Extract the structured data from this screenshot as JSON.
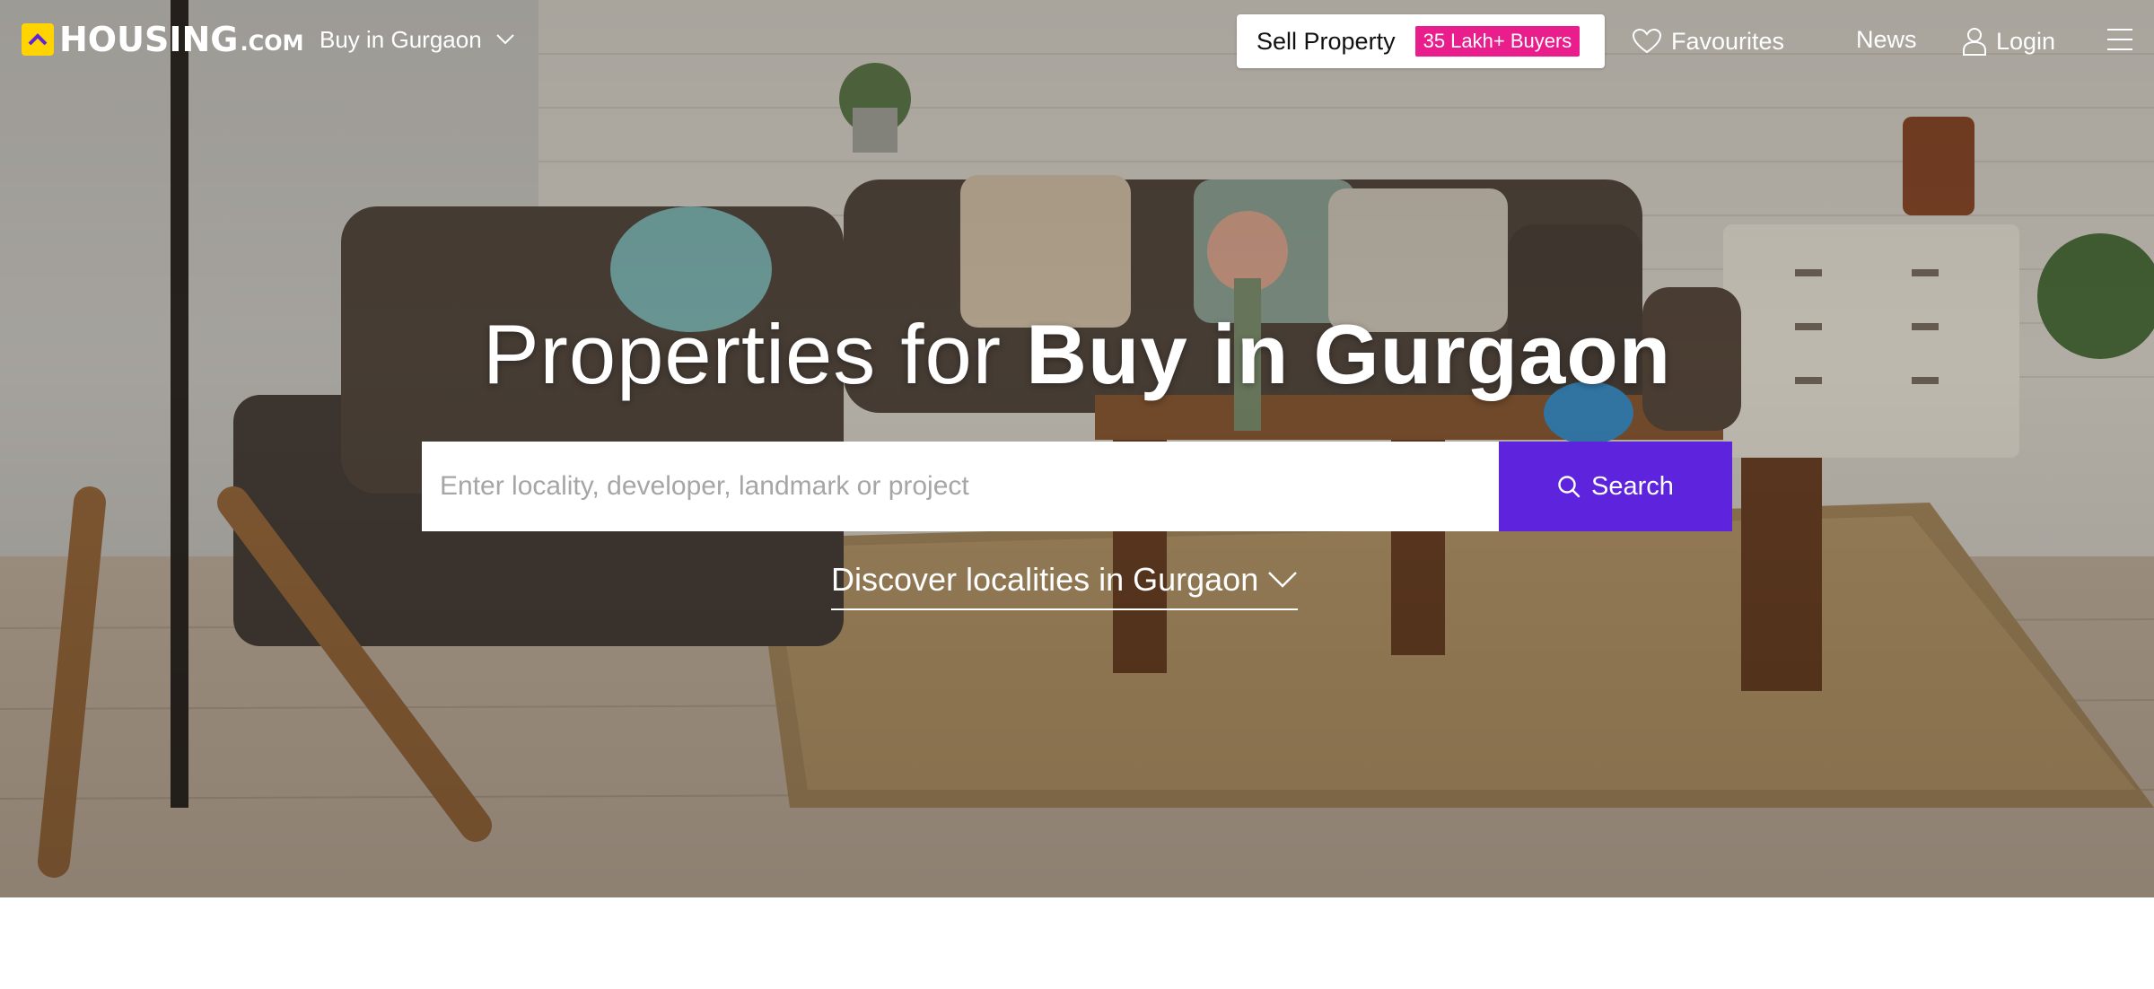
{
  "brand": {
    "logo_text": "HOUSING",
    "logo_suffix": ".COM",
    "logo_color": "#ffd400"
  },
  "nav": {
    "city_select": "Buy in Gurgaon",
    "sell_property": "Sell Property",
    "sell_badge": "35 Lakh+ Buyers",
    "favourites": "Favourites",
    "news": "News",
    "login": "Login"
  },
  "hero": {
    "headline_lead": "Properties for ",
    "headline_strong": "Buy in Gurgaon",
    "search_placeholder": "Enter locality, developer, landmark or project",
    "search_button": "Search",
    "discover_link": "Discover localities in Gurgaon"
  },
  "icons": {
    "logo": "housing-logo-icon",
    "city_dropdown": "chevron-down-icon",
    "favourites": "heart-icon",
    "login": "user-icon",
    "menu": "hamburger-menu-icon",
    "search": "search-icon",
    "discover": "chevron-down-icon"
  },
  "colors": {
    "accent": "#5e23dc",
    "badge": "#e91e8c",
    "logo": "#ffd400"
  }
}
